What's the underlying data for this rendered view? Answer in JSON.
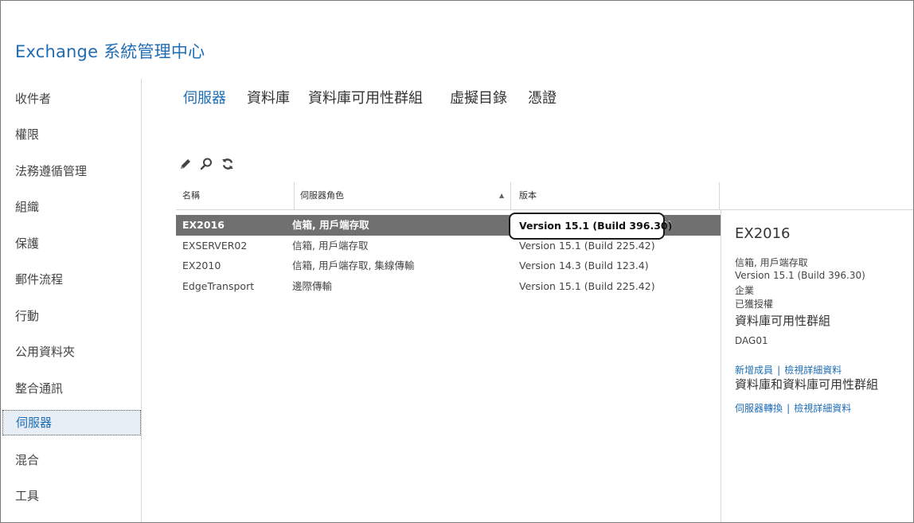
{
  "app": {
    "title": "Exchange 系統管理中心"
  },
  "sidebar": {
    "items": [
      {
        "label": "收件者"
      },
      {
        "label": "權限"
      },
      {
        "label": "法務遵循管理"
      },
      {
        "label": "組織"
      },
      {
        "label": "保護"
      },
      {
        "label": "郵件流程"
      },
      {
        "label": "行動"
      },
      {
        "label": "公用資料夾"
      },
      {
        "label": "整合通訊"
      },
      {
        "label": "伺服器"
      },
      {
        "label": "混合"
      },
      {
        "label": "工具"
      }
    ],
    "active": "伺服器"
  },
  "tabs": [
    {
      "label": "伺服器",
      "active": true
    },
    {
      "label": "資料庫",
      "active": false
    },
    {
      "label": "資料庫可用性群組",
      "active": false
    },
    {
      "label": "虛擬目錄",
      "active": false
    },
    {
      "label": "憑證",
      "active": false
    }
  ],
  "toolbar": {
    "icons": [
      "edit-icon",
      "search-icon",
      "refresh-icon"
    ]
  },
  "table": {
    "headers": {
      "name": "名稱",
      "roles": "伺服器角色",
      "version": "版本"
    },
    "sort_column": "roles",
    "sort_direction": "ascending",
    "rows": [
      {
        "name": "EX2016",
        "roles": "信箱, 用戶端存取",
        "version": "Version 15.1 (Build 396.30)",
        "selected": true
      },
      {
        "name": "EXSERVER02",
        "roles": "信箱, 用戶端存取",
        "version": "Version 15.1 (Build 225.42)",
        "selected": false
      },
      {
        "name": "EX2010",
        "roles": "信箱, 用戶端存取, 集線傳輸",
        "version": "Version 14.3 (Build 123.4)",
        "selected": false
      },
      {
        "name": "EdgeTransport",
        "roles": "邊際傳輸",
        "version": "Version 15.1 (Build 225.42)",
        "selected": false
      }
    ]
  },
  "details": {
    "title": "EX2016",
    "roles": "信箱, 用戶端存取",
    "version": "Version 15.1 (Build 396.30)",
    "edition": "企業",
    "license": "已獲授權",
    "dag_heading": "資料庫可用性群組",
    "dag_name": "DAG01",
    "dag_link_add": "新增成員",
    "dag_link_view": "檢視詳細資料",
    "db_heading": "資料庫和資料庫可用性群組",
    "db_link_switch": "伺服器轉換",
    "db_link_view": "檢視詳細資料",
    "link_separator": "|"
  },
  "colors": {
    "accent": "#1f6db5",
    "selected_row": "#707070",
    "border": "#d6d6d6"
  }
}
